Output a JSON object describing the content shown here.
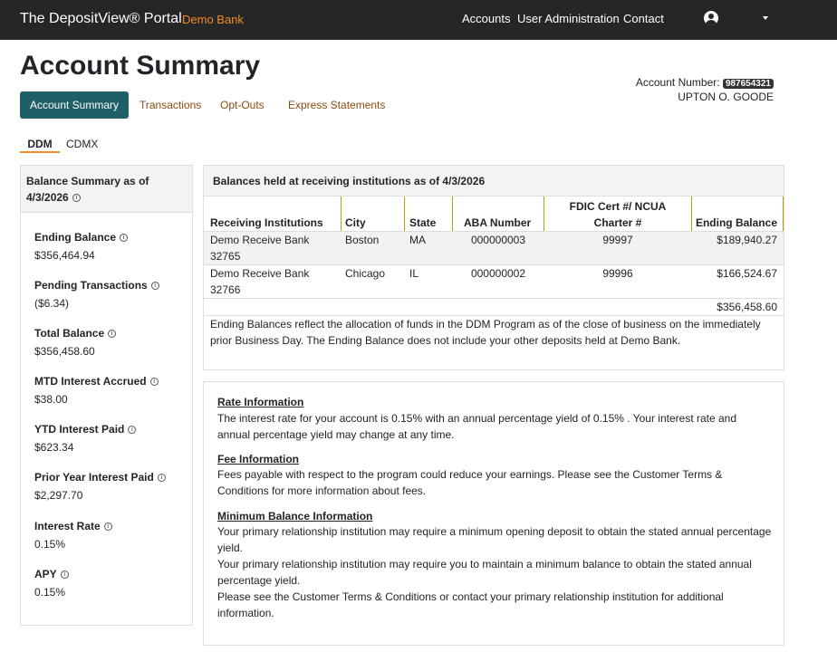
{
  "header": {
    "brand": "The DepositView® Portal",
    "bank": "Demo Bank",
    "nav": [
      "Accounts",
      "User Administration",
      "Contact"
    ]
  },
  "page_title": "Account Summary",
  "account": {
    "number_label": "Account Number:",
    "number": "987654321",
    "holder": "UPTON O. GOODE"
  },
  "tabs": [
    "Account Summary",
    "Transactions",
    "Opt-Outs",
    "Express Statements"
  ],
  "subtabs": [
    "DDM",
    "CDMX"
  ],
  "balance_summary": {
    "title": "Balance Summary as of",
    "date": "4/3/2026",
    "items": [
      {
        "label": "Ending Balance",
        "value": "$356,464.94"
      },
      {
        "label": "Pending Transactions",
        "value": "($6.34)"
      },
      {
        "label": "Total Balance",
        "value": "$356,458.60"
      },
      {
        "label": "MTD Interest Accrued",
        "value": "$38.00"
      },
      {
        "label": "YTD Interest Paid",
        "value": "$623.34"
      },
      {
        "label": "Prior Year Interest Paid",
        "value": "$2,297.70"
      },
      {
        "label": "Interest Rate",
        "value": "0.15%"
      },
      {
        "label": "APY",
        "value": "0.15%"
      }
    ]
  },
  "balances": {
    "title": "Balances held at receiving institutions as of 4/3/2026",
    "columns": [
      "Receiving Institutions",
      "City",
      "State",
      "ABA Number",
      "FDIC Cert #/ NCUA",
      "Charter #",
      "Ending Balance"
    ],
    "rows": [
      {
        "name": "Demo Receive Bank",
        "id": "32765",
        "city": "Boston",
        "state": "MA",
        "aba": "000000003",
        "cert": "99997",
        "balance": "$189,940.27"
      },
      {
        "name": "Demo Receive Bank",
        "id": "32766",
        "city": "Chicago",
        "state": "IL",
        "aba": "000000002",
        "cert": "99996",
        "balance": "$166,524.67"
      }
    ],
    "total": "$356,458.60",
    "note": "Ending Balances reflect the allocation of funds in the DDM Program as of the close of business on the immediately prior Business Day. The Ending Balance does not include your other deposits held at Demo Bank."
  },
  "info": {
    "rate_title": "Rate Information",
    "rate_text": "The interest rate for your account is 0.15% with an annual percentage yield of 0.15% . Your interest rate and annual percentage yield may change at any time.",
    "fee_title": "Fee Information",
    "fee_text": "Fees payable with respect to the program could reduce your earnings. Please see the Customer Terms & Conditions for more information about fees.",
    "min_title": "Minimum Balance Information",
    "min_text_1": "Your primary relationship institution may require a minimum opening deposit to obtain the stated annual percentage yield.",
    "min_text_2": "Your primary relationship institution may require you to maintain a minimum balance to obtain the stated annual percentage yield.",
    "min_text_3": "Please see the Customer Terms & Conditions or contact your primary relationship institution for additional information."
  },
  "icons": {
    "user": "user-circle-icon",
    "caret": "caret-down-icon",
    "info": "info-icon"
  },
  "colors": {
    "navbar": "#262626",
    "accent": "#f28c28",
    "active_tab": "#1e5f68",
    "link": "#8a4b0f"
  }
}
